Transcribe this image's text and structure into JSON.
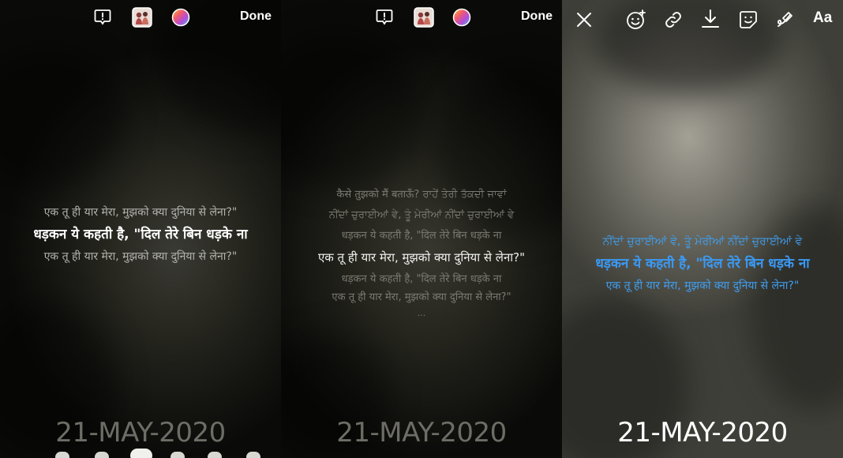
{
  "panel1": {
    "done_label": "Done",
    "lyrics": {
      "prev": "एक तू ही यार मेरा, मुझको क्या दुनिया से लेना?\"",
      "current": "धड़कन ये कहती है, \"दिल तेरे बिन धड़के ना",
      "next": "एक तू ही यार मेरा, मुझको क्या दुनिया से लेना?\""
    },
    "date": "21-MAY-2020"
  },
  "panel2": {
    "done_label": "Done",
    "lyrics": {
      "line1": "कैसे तुझको मैं बताऊँ? ਰਾਹੇਂ ਤੇਰੀ ਤੱਕਦੀ ਜਾਵਾਂ",
      "line2": "ਨੀਂਦਾਂ ਚੁਰਾਈਆਂ ਵੇ, ਤੂੰ ਮੇਰੀਆਂ ਨੀਂਦਾਂ ਚੁਰਾਈਆਂ ਵੇ",
      "line3": "धड़कन ये कहती है, \"दिल तेरे बिन धड़के ना",
      "current": "एक तू ही यार मेरा, मुझको क्या दुनिया से लेना?\"",
      "line5": "धड़कन ये कहती है, \"दिल तेरे बिन धड़के ना",
      "line6": "एक तू ही यार मेरा, मुझको क्या दुनिया से लेना?\"",
      "ellipsis": "..."
    },
    "date": "21-MAY-2020"
  },
  "panel3": {
    "aa_label": "Aa",
    "lyrics": {
      "prev": "ਨੀਂਦਾਂ ਚੁਰਾਈਆਂ ਵੇ, ਤੂੰ ਮੇਰੀਆਂ ਨੀਂਦਾਂ ਚੁਰਾਈਆਂ ਵੇ",
      "current": "धड़कन ये कहती है, \"दिल तेरे बिन धड़के ना",
      "next": "एक तू ही यार मेरा, मुझको क्या दुनिया से लेना?\""
    },
    "date": "21-MAY-2020"
  },
  "icons": {
    "panel1": [
      "report-icon",
      "album-art-thumbnail",
      "color-picker-icon"
    ],
    "panel2": [
      "report-icon",
      "album-art-thumbnail",
      "color-picker-icon"
    ],
    "panel3": [
      "close-icon",
      "emoji-sticker-icon",
      "link-icon",
      "download-icon",
      "sticker-icon",
      "draw-icon"
    ]
  },
  "colors": {
    "lyric_blue": "#3a9af5",
    "date_grey": "#6d6d66",
    "date_white": "#ffffff"
  }
}
